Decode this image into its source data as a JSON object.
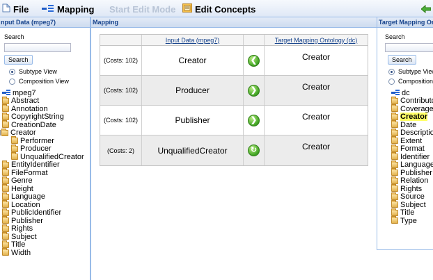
{
  "toolbar": {
    "file": "File",
    "mapping": "Mapping",
    "start_edit_mode": "Start Edit Mode",
    "edit_concepts": "Edit Concepts"
  },
  "left_panel": {
    "title": "nput Data (mpeg7)",
    "search_label": "Search",
    "search_value": "",
    "search_button": "Search",
    "view_options": [
      "Subtype View",
      "Composition View"
    ],
    "selected_view": "Subtype View",
    "tree": [
      {
        "label": "mpeg7",
        "level": 0,
        "kind": "root"
      },
      {
        "label": "Abstract",
        "level": 0,
        "kind": "folder"
      },
      {
        "label": "Annotation",
        "level": 0,
        "kind": "folder"
      },
      {
        "label": "CopyrightString",
        "level": 0,
        "kind": "folder"
      },
      {
        "label": "CreationDate",
        "level": 0,
        "kind": "folder"
      },
      {
        "label": "Creator",
        "level": 0,
        "kind": "folder",
        "expanded": true
      },
      {
        "label": "Performer",
        "level": 1,
        "kind": "folder"
      },
      {
        "label": "Producer",
        "level": 1,
        "kind": "folder"
      },
      {
        "label": "UnqualifiedCreator",
        "level": 1,
        "kind": "folder"
      },
      {
        "label": "EntityIdentifier",
        "level": 0,
        "kind": "folder"
      },
      {
        "label": "FileFormat",
        "level": 0,
        "kind": "folder"
      },
      {
        "label": "Genre",
        "level": 0,
        "kind": "folder"
      },
      {
        "label": "Height",
        "level": 0,
        "kind": "folder"
      },
      {
        "label": "Language",
        "level": 0,
        "kind": "folder"
      },
      {
        "label": "Location",
        "level": 0,
        "kind": "folder"
      },
      {
        "label": "PublicIdentifier",
        "level": 0,
        "kind": "folder"
      },
      {
        "label": "Publisher",
        "level": 0,
        "kind": "folder"
      },
      {
        "label": "Rights",
        "level": 0,
        "kind": "folder"
      },
      {
        "label": "Subject",
        "level": 0,
        "kind": "folder"
      },
      {
        "label": "Title",
        "level": 0,
        "kind": "folder"
      },
      {
        "label": "Width",
        "level": 0,
        "kind": "folder"
      }
    ]
  },
  "mapping_panel": {
    "title": "Mapping",
    "col_input": "Input Data (mpeg7)",
    "col_target": "Target Mapping Ontology (dc)",
    "rows": [
      {
        "cost": "(Costs: 102)",
        "input": "Creator",
        "target": "Creator",
        "arrow": "left"
      },
      {
        "cost": "(Costs: 102)",
        "input": "Producer",
        "target": "Creator",
        "arrow": "right"
      },
      {
        "cost": "(Costs: 102)",
        "input": "Publisher",
        "target": "Creator",
        "arrow": "right"
      },
      {
        "cost": "(Costs: 2)",
        "input": "UnqualifiedCreator",
        "target": "Creator",
        "arrow": "swap"
      }
    ]
  },
  "right_panel": {
    "title": "Target Mapping Ont",
    "search_label": "Search",
    "search_value": "",
    "search_button": "Search",
    "view_options": [
      "Subtype View",
      "Composition V"
    ],
    "selected_view": "Subtype View",
    "tree": [
      {
        "label": "dc",
        "kind": "root"
      },
      {
        "label": "Contributo",
        "kind": "folder"
      },
      {
        "label": "Coverage",
        "kind": "folder"
      },
      {
        "label": "Creator",
        "kind": "folder",
        "highlighted": true
      },
      {
        "label": "Date",
        "kind": "folder"
      },
      {
        "label": "Descriptio",
        "kind": "folder"
      },
      {
        "label": "Extent",
        "kind": "folder"
      },
      {
        "label": "Format",
        "kind": "folder"
      },
      {
        "label": "Identifier",
        "kind": "folder"
      },
      {
        "label": "Language",
        "kind": "folder"
      },
      {
        "label": "Publisher",
        "kind": "folder"
      },
      {
        "label": "Relation",
        "kind": "folder"
      },
      {
        "label": "Rights",
        "kind": "folder"
      },
      {
        "label": "Source",
        "kind": "folder"
      },
      {
        "label": "Subject",
        "kind": "folder"
      },
      {
        "label": "Title",
        "kind": "folder"
      },
      {
        "label": "Type",
        "kind": "folder"
      }
    ]
  },
  "colors": {
    "panel_border": "#99bbe8",
    "header_text": "#15428b",
    "highlight": "#ffff66",
    "arrow_green": "#3fa322"
  }
}
